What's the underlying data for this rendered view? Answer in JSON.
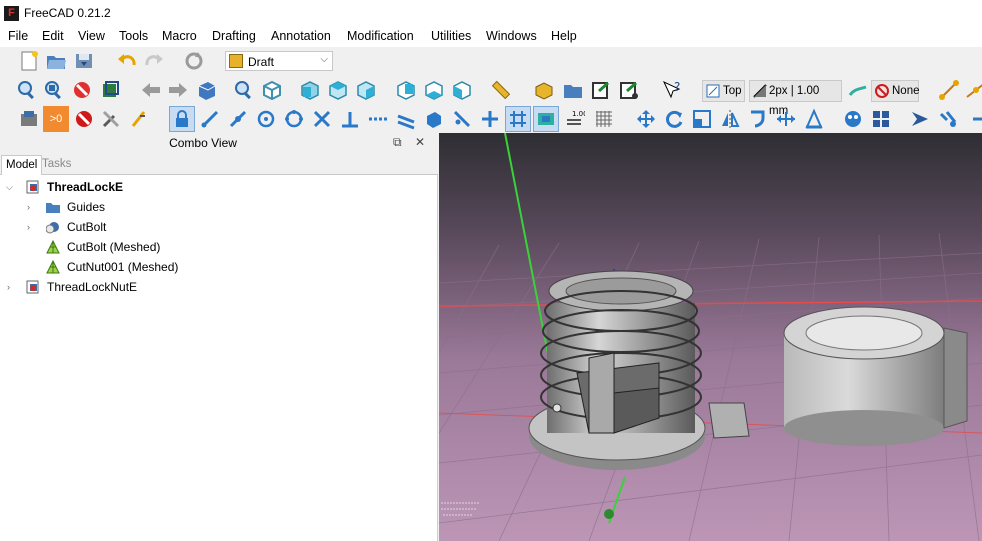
{
  "window": {
    "title": "FreeCAD 0.21.2"
  },
  "menubar": [
    "File",
    "Edit",
    "View",
    "Tools",
    "Macro",
    "Drafting",
    "Annotation",
    "Modification",
    "Utilities",
    "Windows",
    "Help"
  ],
  "toolbar": {
    "workbench": "Draft",
    "working_plane": "Top",
    "line_style": "2px | 1.00 mm",
    "hatch": "None",
    "grid_counter": "1.00",
    "layer_badge": ">0"
  },
  "combo_view": {
    "title": "Combo View",
    "tabs": [
      "Model",
      "Tasks"
    ],
    "tree": [
      {
        "label": "ThreadLockE",
        "icon": "part-document-icon",
        "expanded": true
      },
      {
        "label": "Guides",
        "icon": "folder-icon"
      },
      {
        "label": "CutBolt",
        "icon": "cut-icon"
      },
      {
        "label": "CutBolt (Meshed)",
        "icon": "mesh-icon"
      },
      {
        "label": "CutNut001 (Meshed)",
        "icon": "mesh-icon"
      },
      {
        "label": "ThreadLockNutE",
        "icon": "part-document-icon",
        "expanded": false
      }
    ]
  },
  "colors": {
    "viewport_top": "#2e2e33",
    "viewport_bottom": "#b78fb0",
    "grid_line": "#8a6f8a",
    "x_axis": "#e84a4a",
    "y_axis": "#3ad13a",
    "z_axis": "#2733a8",
    "model_gray": "#9c9c9c"
  }
}
